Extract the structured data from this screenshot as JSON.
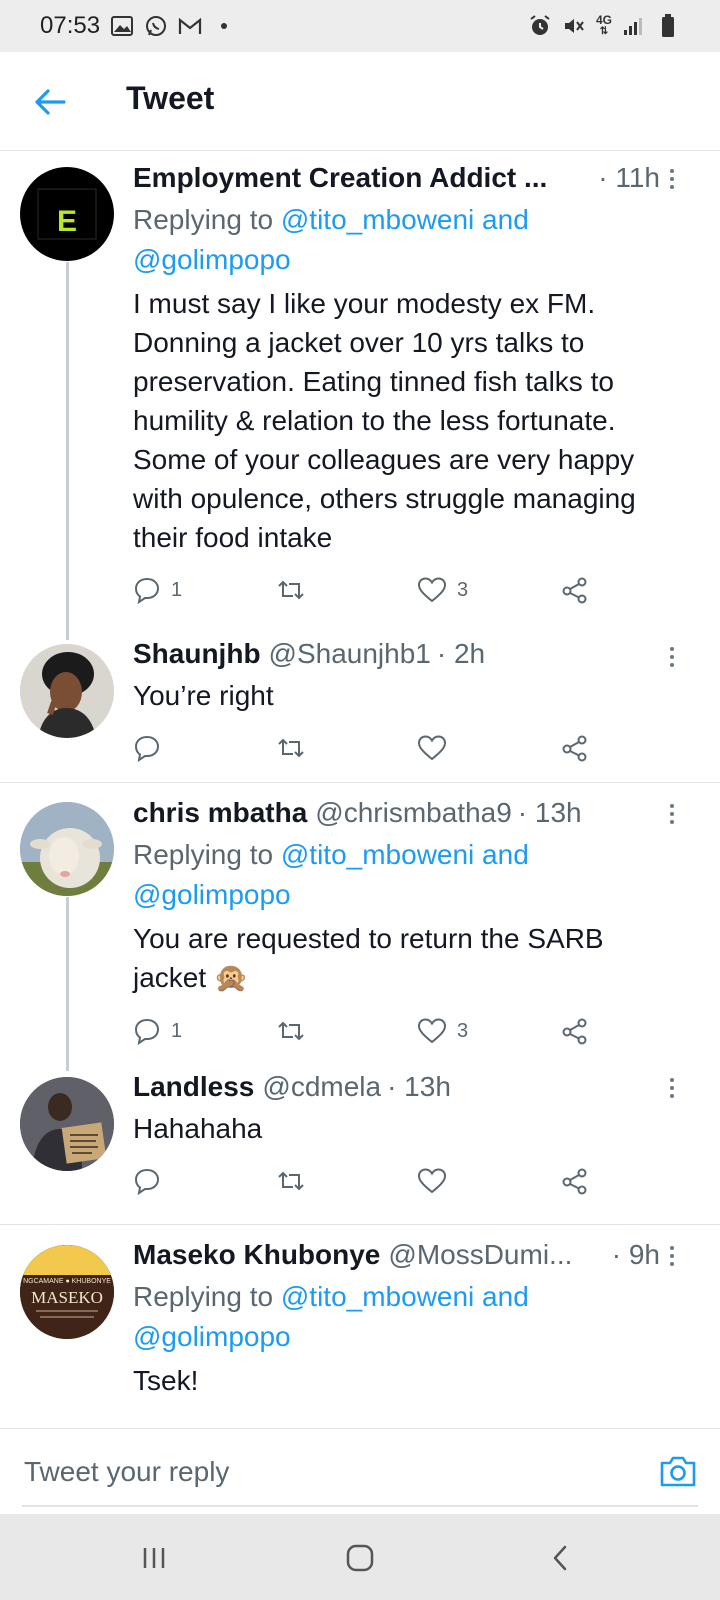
{
  "status_bar": {
    "time": "07:53",
    "left_icons": [
      "gallery-icon",
      "whatsapp-icon",
      "gmail-icon",
      "dot-icon"
    ],
    "network": "4G",
    "right_icons": [
      "alarm-icon",
      "mute-icon",
      "network-icon",
      "signal-icon",
      "battery-icon"
    ]
  },
  "header": {
    "title": "Tweet",
    "back_icon": "arrow-left-icon"
  },
  "tweets": [
    {
      "name": "Employment Creation Addict ...",
      "handle": "",
      "time": "· 11h",
      "reply_prefix": "Replying to ",
      "reply_mentions": "@tito_mboweni and",
      "reply_mentions_2": "@golimpopo",
      "body": "I must say I like your modesty ex FM. Donning a jacket over 10 yrs talks to preservation. Eating tinned fish talks to humility & relation to the less fortunate. Some of your colleagues are very happy with opulence, others struggle managing their food intake",
      "replies": "1",
      "retweets": "",
      "likes": "3",
      "avatar_letter": "E"
    },
    {
      "name": "Shaunjhb",
      "handle": "@Shaunjhb1",
      "time": "· 2h",
      "body": "You’re right",
      "replies": "",
      "retweets": "",
      "likes": ""
    },
    {
      "name": "chris mbatha",
      "handle": "@chrismbatha9",
      "time": "· 13h",
      "reply_prefix": "Replying to ",
      "reply_mentions": "@tito_mboweni and",
      "reply_mentions_2": "@golimpopo",
      "body": "You are requested to return the SARB jacket 🙊",
      "replies": "1",
      "retweets": "",
      "likes": "3"
    },
    {
      "name": "Landless",
      "handle": "@cdmela",
      "time": "· 13h",
      "body": "Hahahaha",
      "replies": "",
      "retweets": "",
      "likes": ""
    },
    {
      "name": "Maseko Khubonye",
      "handle": "@MossDumi...",
      "time": "· 9h",
      "reply_prefix": "Replying to ",
      "reply_mentions": "@tito_mboweni and",
      "reply_mentions_2": "@golimpopo",
      "body": "Tsek!",
      "avatar_text_top": "NGCAMANE ● KHUBONYE",
      "avatar_text_main": "MASEKO"
    }
  ],
  "reply_bar": {
    "placeholder": "Tweet your reply",
    "camera_icon": "camera-icon"
  },
  "nav_bar": {
    "icons": [
      "recents-icon",
      "home-icon",
      "back-icon"
    ]
  },
  "colors": {
    "accent": "#1d9bf0",
    "text": "#141823",
    "muted": "#5b6770",
    "divider": "#e1e4e8"
  }
}
